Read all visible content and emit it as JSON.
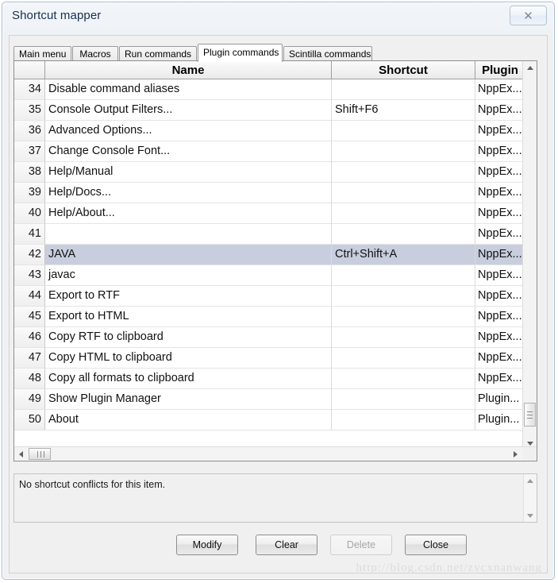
{
  "window": {
    "title": "Shortcut mapper",
    "close_glyph": "✕"
  },
  "tabs": [
    {
      "label": "Main menu",
      "selected": false
    },
    {
      "label": "Macros",
      "selected": false
    },
    {
      "label": "Run commands",
      "selected": false
    },
    {
      "label": "Plugin commands",
      "selected": true
    },
    {
      "label": "Scintilla commands",
      "selected": false
    }
  ],
  "table": {
    "columns": [
      "",
      "Name",
      "Shortcut",
      "Plugin"
    ],
    "rows": [
      {
        "index": "34",
        "name": "Disable command aliases",
        "shortcut": "",
        "plugin": "NppEx...",
        "selected": false
      },
      {
        "index": "35",
        "name": "Console Output Filters...",
        "shortcut": "Shift+F6",
        "plugin": "NppEx...",
        "selected": false
      },
      {
        "index": "36",
        "name": "Advanced Options...",
        "shortcut": "",
        "plugin": "NppEx...",
        "selected": false
      },
      {
        "index": "37",
        "name": "Change Console Font...",
        "shortcut": "",
        "plugin": "NppEx...",
        "selected": false
      },
      {
        "index": "38",
        "name": "Help/Manual",
        "shortcut": "",
        "plugin": "NppEx...",
        "selected": false
      },
      {
        "index": "39",
        "name": "Help/Docs...",
        "shortcut": "",
        "plugin": "NppEx...",
        "selected": false
      },
      {
        "index": "40",
        "name": "Help/About...",
        "shortcut": "",
        "plugin": "NppEx...",
        "selected": false
      },
      {
        "index": "41",
        "name": "",
        "shortcut": "",
        "plugin": "NppEx...",
        "selected": false
      },
      {
        "index": "42",
        "name": "JAVA",
        "shortcut": "Ctrl+Shift+A",
        "plugin": "NppEx...",
        "selected": true
      },
      {
        "index": "43",
        "name": "javac",
        "shortcut": "",
        "plugin": "NppEx...",
        "selected": false
      },
      {
        "index": "44",
        "name": "Export to RTF",
        "shortcut": "",
        "plugin": "NppEx...",
        "selected": false
      },
      {
        "index": "45",
        "name": "Export to HTML",
        "shortcut": "",
        "plugin": "NppEx...",
        "selected": false
      },
      {
        "index": "46",
        "name": "Copy RTF to clipboard",
        "shortcut": "",
        "plugin": "NppEx...",
        "selected": false
      },
      {
        "index": "47",
        "name": "Copy HTML to clipboard",
        "shortcut": "",
        "plugin": "NppEx...",
        "selected": false
      },
      {
        "index": "48",
        "name": "Copy all formats to clipboard",
        "shortcut": "",
        "plugin": "NppEx...",
        "selected": false
      },
      {
        "index": "49",
        "name": "Show Plugin Manager",
        "shortcut": "",
        "plugin": "Plugin...",
        "selected": false
      },
      {
        "index": "50",
        "name": "About",
        "shortcut": "",
        "plugin": "Plugin...",
        "selected": false
      }
    ]
  },
  "conflicts": {
    "message": "No shortcut conflicts for this item."
  },
  "buttons": {
    "modify": "Modify",
    "clear": "Clear",
    "delete": "Delete",
    "close": "Close"
  },
  "watermark": {
    "text": "http://blog.csdn.net/zycxnanwang"
  },
  "colors": {
    "selection": "#c8cedd",
    "window_border": "#a8bcd0",
    "title_text": "#17304d"
  }
}
